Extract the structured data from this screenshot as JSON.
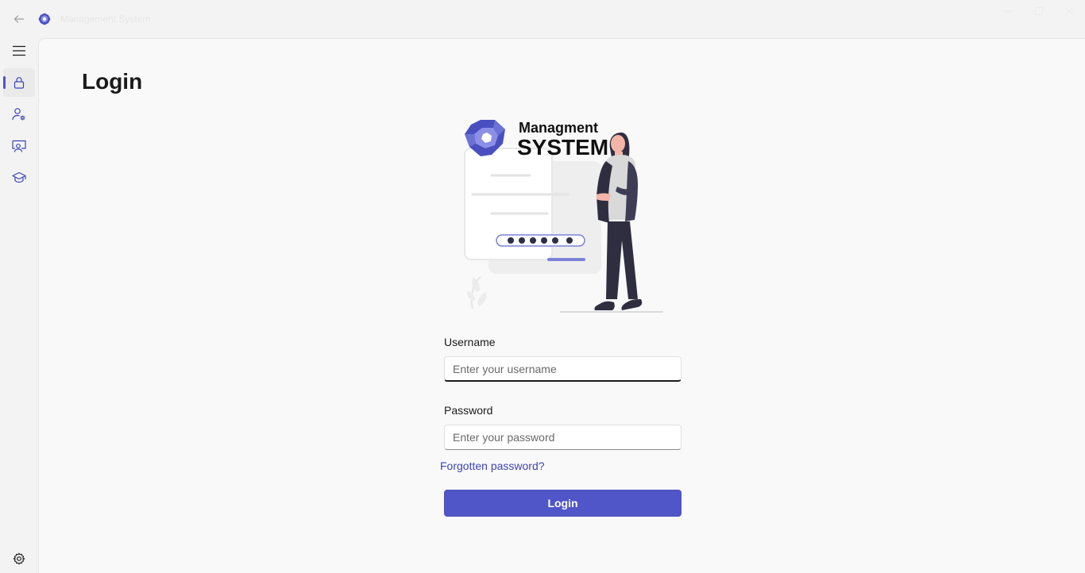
{
  "window": {
    "title": "Management System"
  },
  "nav": {
    "items": [
      {
        "icon": "menu-icon"
      },
      {
        "icon": "lock-icon",
        "selected": true
      },
      {
        "icon": "user-settings-icon"
      },
      {
        "icon": "presentation-user-icon"
      },
      {
        "icon": "graduation-cap-icon"
      },
      {
        "icon": "gear-icon"
      }
    ]
  },
  "page": {
    "title": "Login"
  },
  "illustration": {
    "brand_line1": "Managment",
    "brand_line2": "SYSTEM"
  },
  "form": {
    "username_label": "Username",
    "username_placeholder": "Enter your username",
    "username_value": "",
    "password_label": "Password",
    "password_placeholder": "Enter your password",
    "password_value": "",
    "forgot_link": "Forgotten password?",
    "login_button": "Login"
  },
  "colors": {
    "accent": "#5056c8",
    "link": "#3d44b8",
    "logo_dark": "#4a4fbf",
    "logo_light": "#8b8fe6"
  }
}
